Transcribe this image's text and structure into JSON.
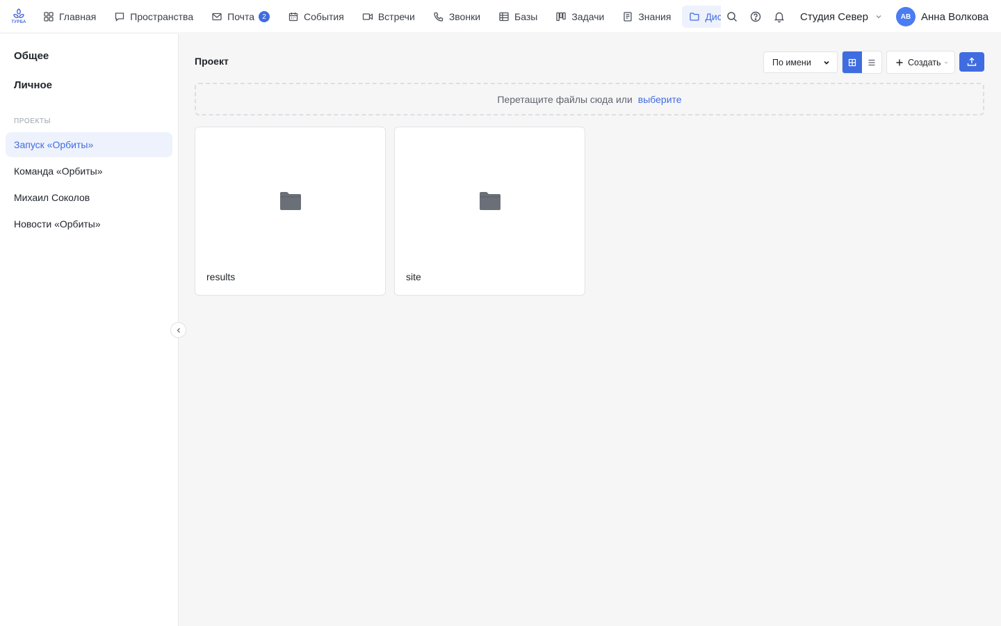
{
  "logo": {
    "text": "ТУРБА"
  },
  "nav": [
    {
      "label": "Главная",
      "icon": "grid-icon"
    },
    {
      "label": "Пространства",
      "icon": "chat-icon"
    },
    {
      "label": "Почта",
      "icon": "mail-icon",
      "badge": "2"
    },
    {
      "label": "События",
      "icon": "calendar-icon"
    },
    {
      "label": "Встречи",
      "icon": "video-icon"
    },
    {
      "label": "Звонки",
      "icon": "phone-icon"
    },
    {
      "label": "Базы",
      "icon": "table-icon"
    },
    {
      "label": "Задачи",
      "icon": "kanban-icon"
    },
    {
      "label": "Знания",
      "icon": "notebook-icon"
    },
    {
      "label": "Диск",
      "icon": "folder-icon",
      "active": true
    }
  ],
  "header": {
    "studio": "Студия Север",
    "user": {
      "initials": "АВ",
      "name": "Анна Волкова"
    }
  },
  "sidebar": {
    "main": [
      "Общее",
      "Личное"
    ],
    "section_label": "ПРОЕКТЫ",
    "projects": [
      {
        "label": "Запуск «Орбиты»",
        "active": true
      },
      {
        "label": "Команда «Орбиты»"
      },
      {
        "label": "Михаил Соколов"
      },
      {
        "label": "Новости «Орбиты»"
      }
    ]
  },
  "main": {
    "title": "Проект",
    "sort": {
      "selected": "По имени"
    },
    "create_label": "Создать",
    "dropzone": {
      "text": "Перетащите файлы сюда или",
      "link": "выберите"
    },
    "folders": [
      {
        "name": "results"
      },
      {
        "name": "site"
      }
    ]
  },
  "colors": {
    "accent": "#3f6ce0",
    "active_bg": "#eef2fd",
    "folder": "#6b6f78"
  }
}
